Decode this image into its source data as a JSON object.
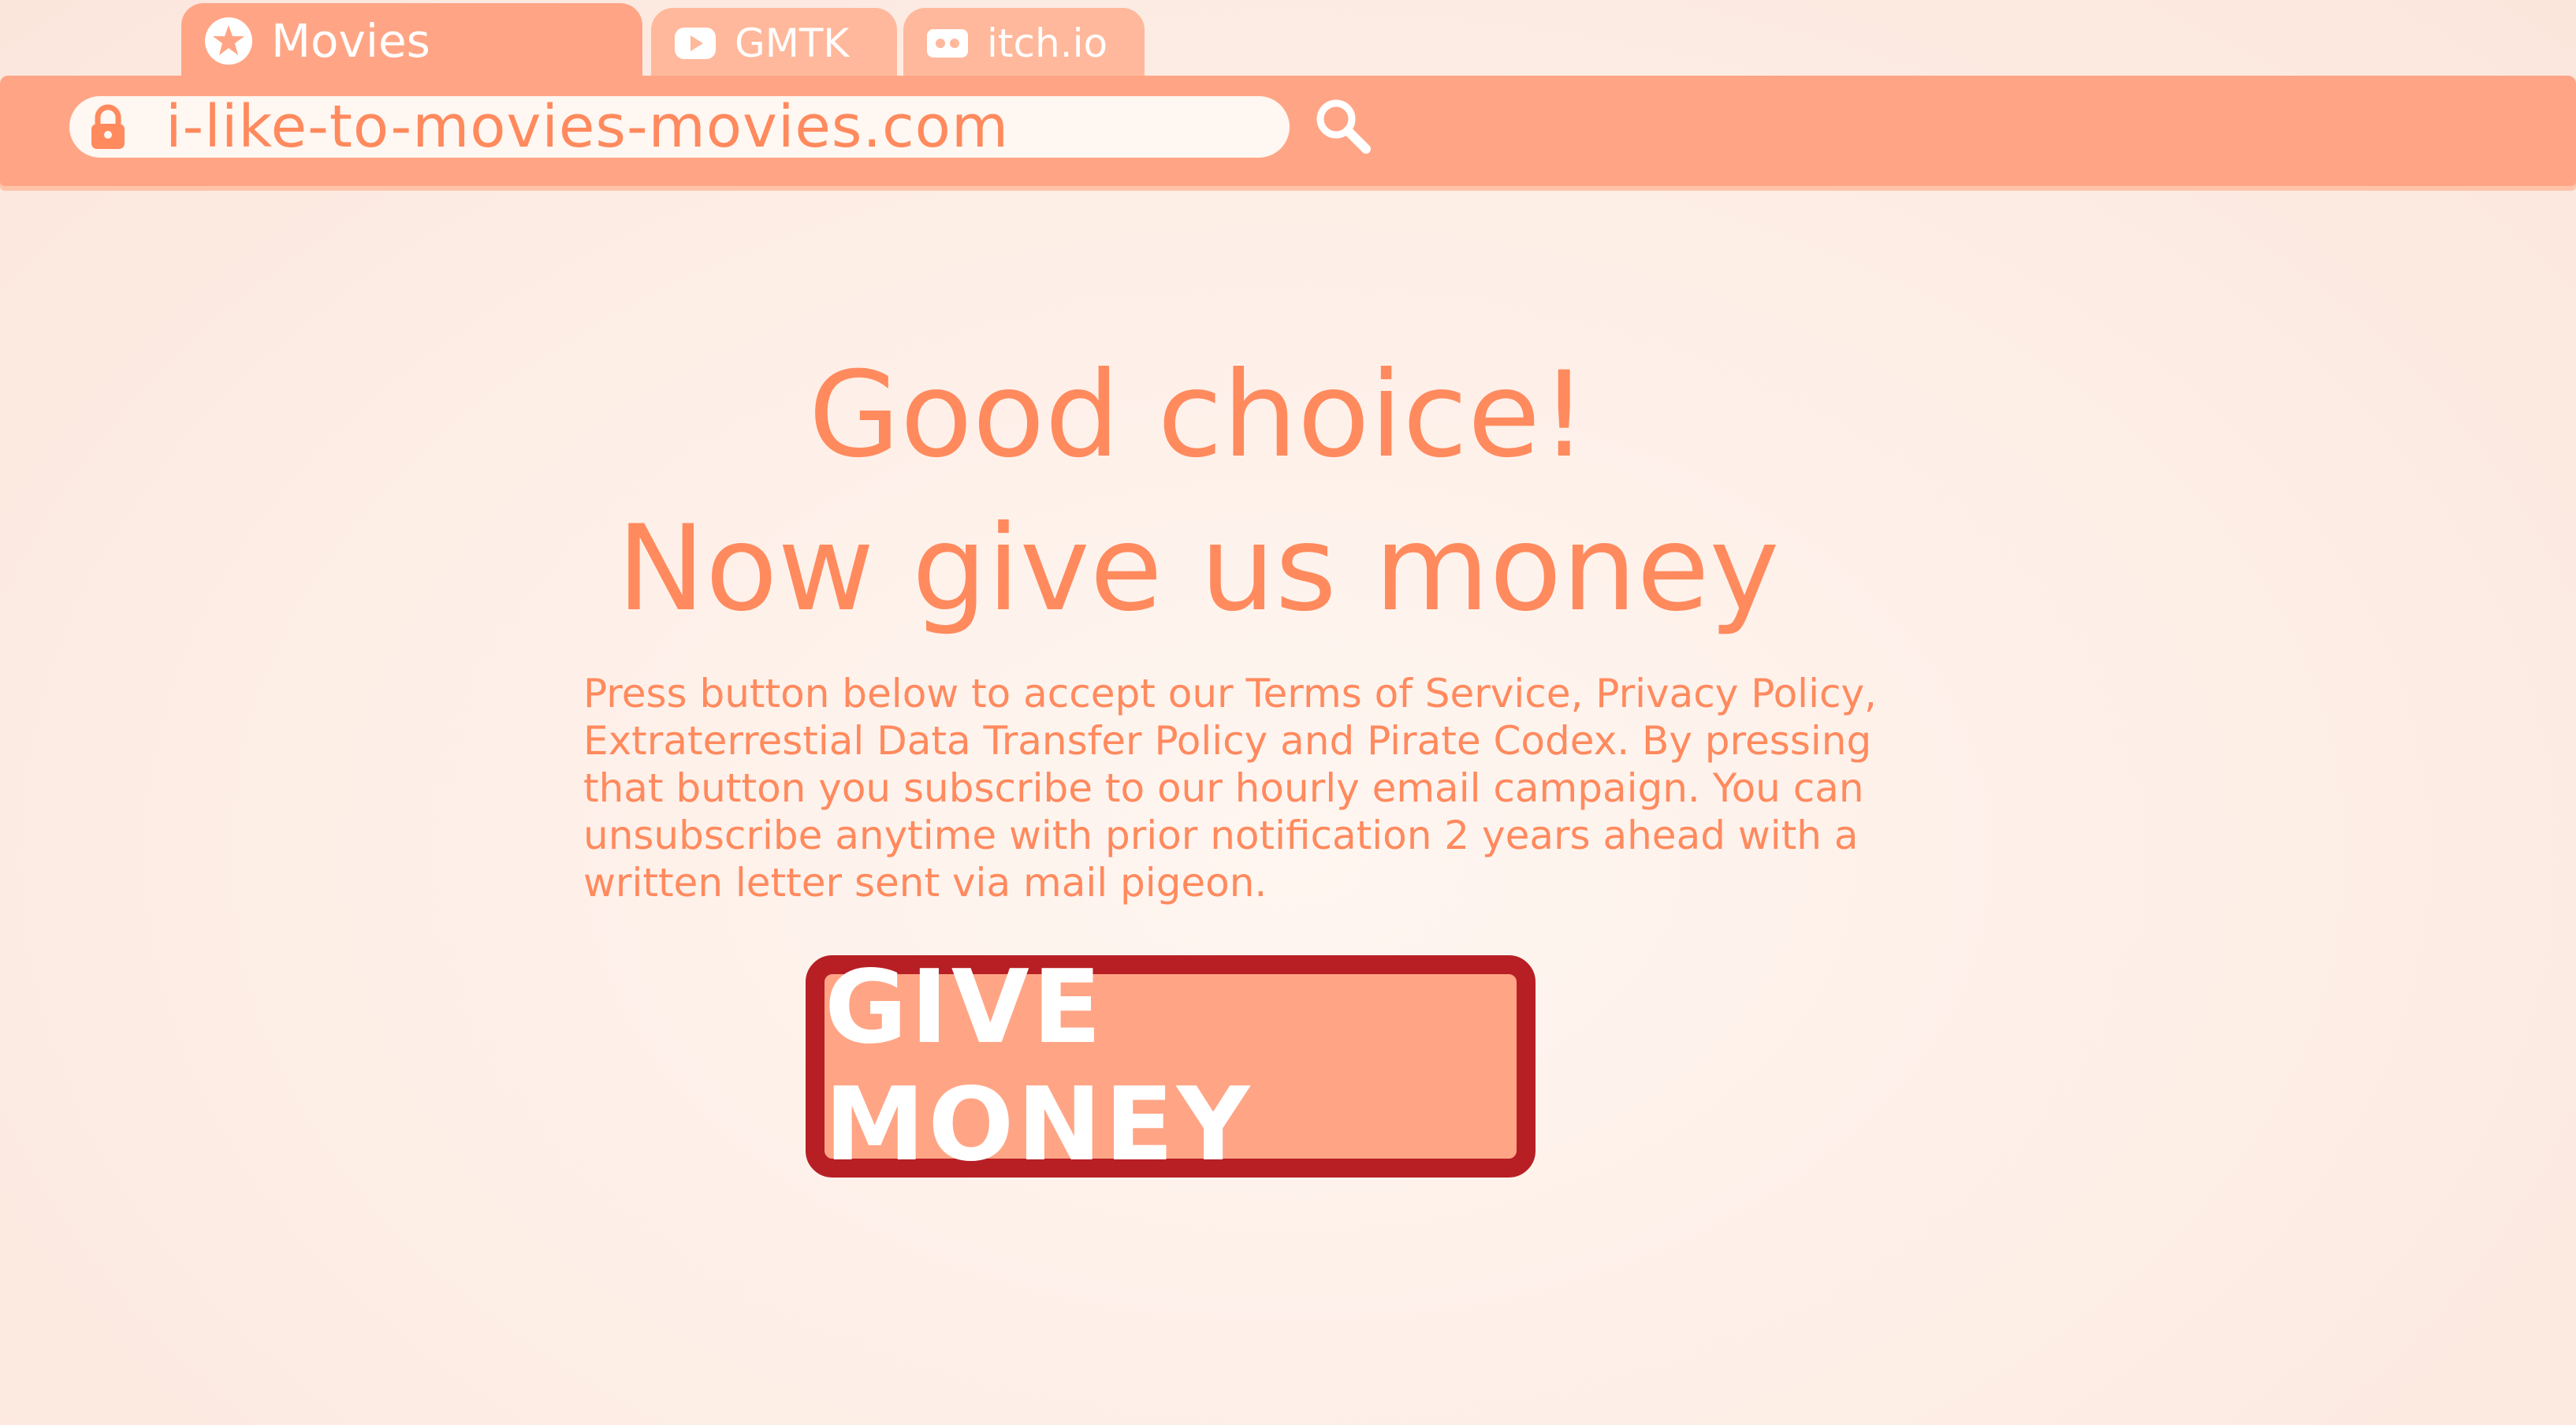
{
  "tabs": [
    {
      "label": "Movies",
      "icon": "star-icon",
      "active": true
    },
    {
      "label": "GMTK",
      "icon": "youtube-icon",
      "active": false
    },
    {
      "label": "itch.io",
      "icon": "itch-icon",
      "active": false
    }
  ],
  "address_bar": {
    "url": "i-like-to-movies-movies.com",
    "lock_icon": "lock-icon",
    "search_icon": "search-icon"
  },
  "main": {
    "headline_line1": "Good choice!",
    "headline_line2": "Now give us money",
    "body": "Press button below to accept our Terms of Service, Privacy Policy, Extraterrestial Data Transfer Policy and Pirate Codex. By pressing that button you subscribe to our hourly email campaign. You can unsubscribe anytime with prior notification 2 years ahead with a written letter sent via mail pigeon.",
    "cta_label": "GIVE MONEY"
  },
  "colors": {
    "accent": "#ffa585",
    "text": "#ff8a5e",
    "button_border": "#b71f25",
    "background": "#fdeee6"
  }
}
